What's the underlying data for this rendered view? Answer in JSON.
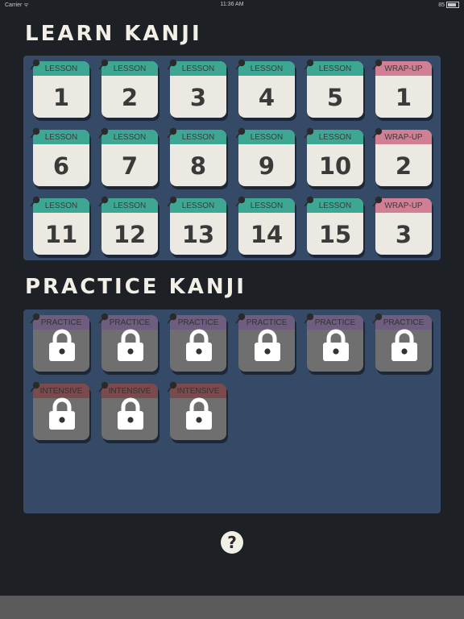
{
  "status_bar": {
    "carrier": "Carrier ᯤ",
    "time": "11:36 AM",
    "battery": "85"
  },
  "learn": {
    "title": "LEARN KANJI",
    "tiles": [
      {
        "kind": "lesson",
        "label": "LESSON",
        "number": "1"
      },
      {
        "kind": "lesson",
        "label": "LESSON",
        "number": "2"
      },
      {
        "kind": "lesson",
        "label": "LESSON",
        "number": "3"
      },
      {
        "kind": "lesson",
        "label": "LESSON",
        "number": "4"
      },
      {
        "kind": "lesson",
        "label": "LESSON",
        "number": "5"
      },
      {
        "kind": "wrap",
        "label": "WRAP-UP",
        "number": "1"
      },
      {
        "kind": "lesson",
        "label": "LESSON",
        "number": "6"
      },
      {
        "kind": "lesson",
        "label": "LESSON",
        "number": "7"
      },
      {
        "kind": "lesson",
        "label": "LESSON",
        "number": "8"
      },
      {
        "kind": "lesson",
        "label": "LESSON",
        "number": "9"
      },
      {
        "kind": "lesson",
        "label": "LESSON",
        "number": "10"
      },
      {
        "kind": "wrap",
        "label": "WRAP-UP",
        "number": "2"
      },
      {
        "kind": "lesson",
        "label": "LESSON",
        "number": "11"
      },
      {
        "kind": "lesson",
        "label": "LESSON",
        "number": "12"
      },
      {
        "kind": "lesson",
        "label": "LESSON",
        "number": "13"
      },
      {
        "kind": "lesson",
        "label": "LESSON",
        "number": "14"
      },
      {
        "kind": "lesson",
        "label": "LESSON",
        "number": "15"
      },
      {
        "kind": "wrap",
        "label": "WRAP-UP",
        "number": "3"
      }
    ]
  },
  "practice": {
    "title": "PRACTICE KANJI",
    "tiles": [
      {
        "kind": "practice",
        "label": "PRACTICE"
      },
      {
        "kind": "practice",
        "label": "PRACTICE"
      },
      {
        "kind": "practice",
        "label": "PRACTICE"
      },
      {
        "kind": "practice",
        "label": "PRACTICE"
      },
      {
        "kind": "practice",
        "label": "PRACTICE"
      },
      {
        "kind": "practice",
        "label": "PRACTICE"
      },
      {
        "kind": "intensive",
        "label": "INTENSIVE"
      },
      {
        "kind": "intensive",
        "label": "INTENSIVE"
      },
      {
        "kind": "intensive",
        "label": "INTENSIVE"
      }
    ]
  },
  "help_label": "?",
  "colors": {
    "background": "#1d2126",
    "panel": "#344a66",
    "lesson_band": "#3ea793",
    "wrap_band": "#d17f94",
    "tile": "#ebe9e1"
  },
  "icons": {
    "pin": "pushpin-icon",
    "lock": "padlock-icon",
    "help": "question-mark-icon"
  }
}
